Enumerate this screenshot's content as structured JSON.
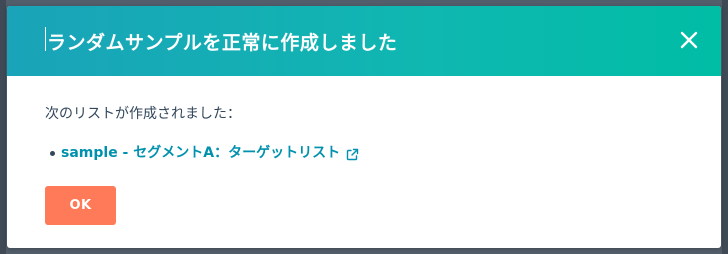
{
  "modal": {
    "title": "ランダムサンプルを正常に作成しました",
    "close_icon": "close-icon",
    "body_text": "次のリストが作成されました：",
    "results": [
      {
        "label": "sample - セグメントA：ターゲットリスト",
        "icon": "external-link-icon"
      }
    ],
    "ok_label": "OK"
  },
  "colors": {
    "header_gradient_start": "#1aa3b9",
    "header_gradient_end": "#00bda5",
    "link": "#0091ae",
    "primary_button": "#ff7a59",
    "text": "#33475b"
  }
}
